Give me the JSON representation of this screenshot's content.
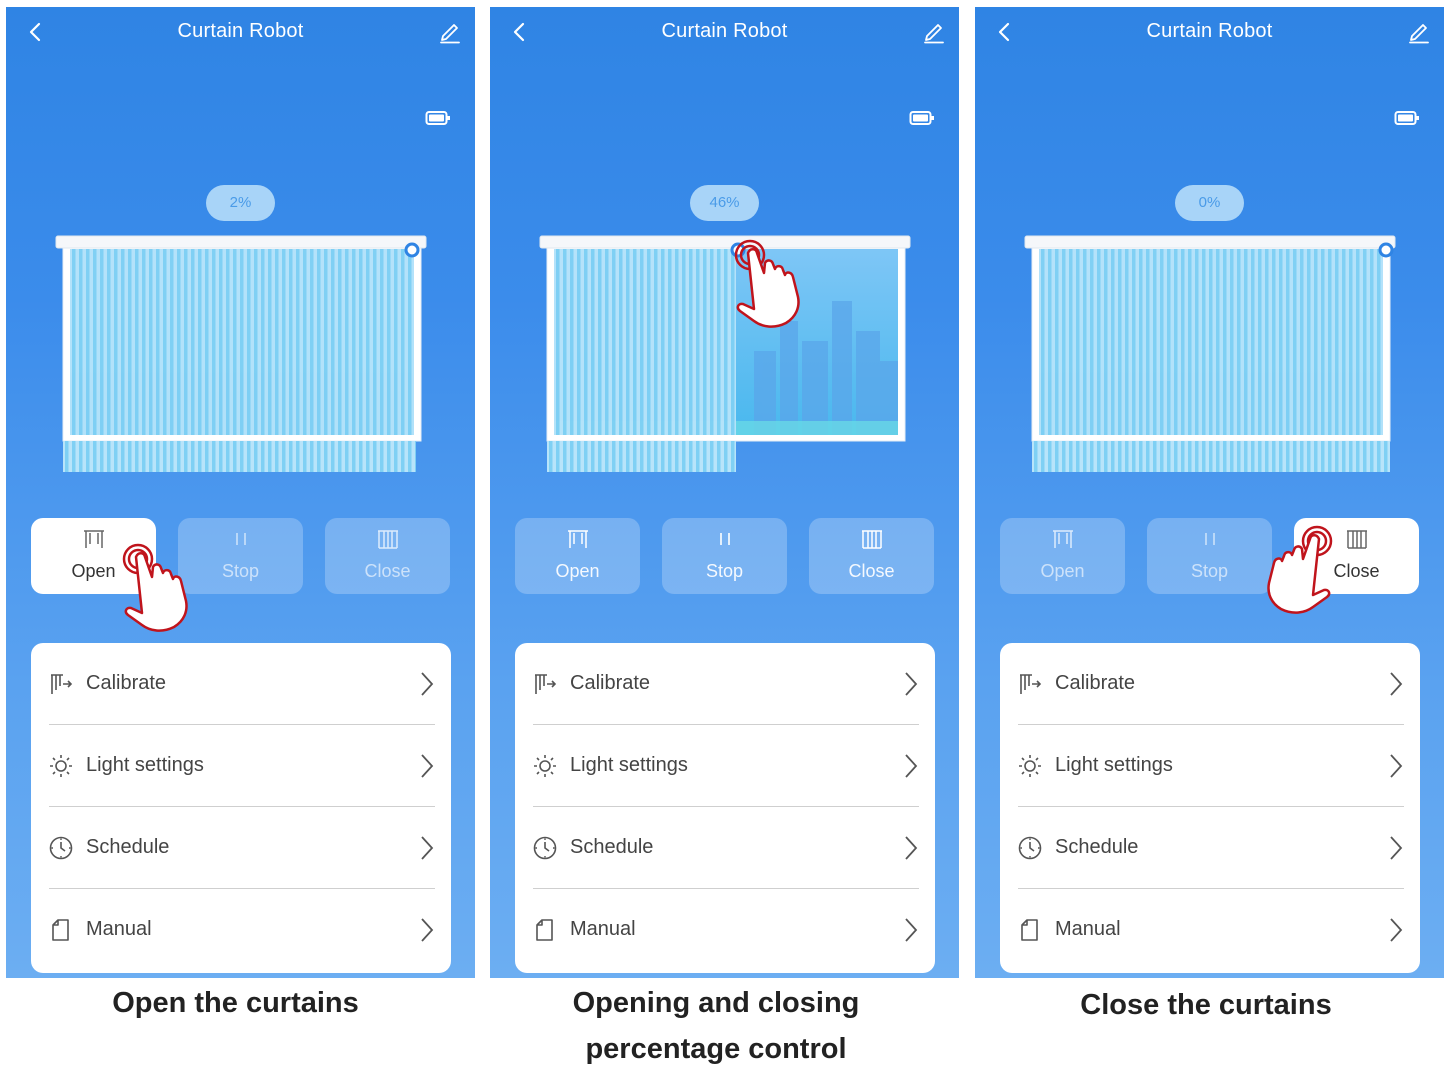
{
  "app_title": "Curtain Robot",
  "colors": {
    "panel_top": "#2f84e4",
    "panel_bottom": "#6caef2",
    "badge_bg": "#a8d4f8",
    "badge_text": "#4a9be8",
    "hand_outline": "#c0141c",
    "curtain_slat": "#7fd0f4",
    "window_sky": "#58bff0"
  },
  "buttons": {
    "open": "Open",
    "stop": "Stop",
    "close": "Close"
  },
  "menu": {
    "calibrate": "Calibrate",
    "light_settings": "Light settings",
    "schedule": "Schedule",
    "manual": "Manual"
  },
  "icons": [
    "back-icon",
    "edit-icon",
    "battery-icon",
    "open-curtain-icon",
    "pause-icon",
    "close-curtain-icon",
    "calibrate-icon",
    "sun-icon",
    "clock-icon",
    "document-icon",
    "chevron-right-icon",
    "tap-hand-icon"
  ],
  "panels": [
    {
      "position_label": "2%",
      "open_fraction": 0.02,
      "active_button": "open",
      "caption": "Open the curtains"
    },
    {
      "position_label": "46%",
      "open_fraction": 0.46,
      "active_button": "none",
      "caption_line1": "Opening and closing",
      "caption_line2": "percentage control"
    },
    {
      "position_label": "0%",
      "open_fraction": 0.0,
      "active_button": "close",
      "caption": "Close the curtains"
    }
  ]
}
